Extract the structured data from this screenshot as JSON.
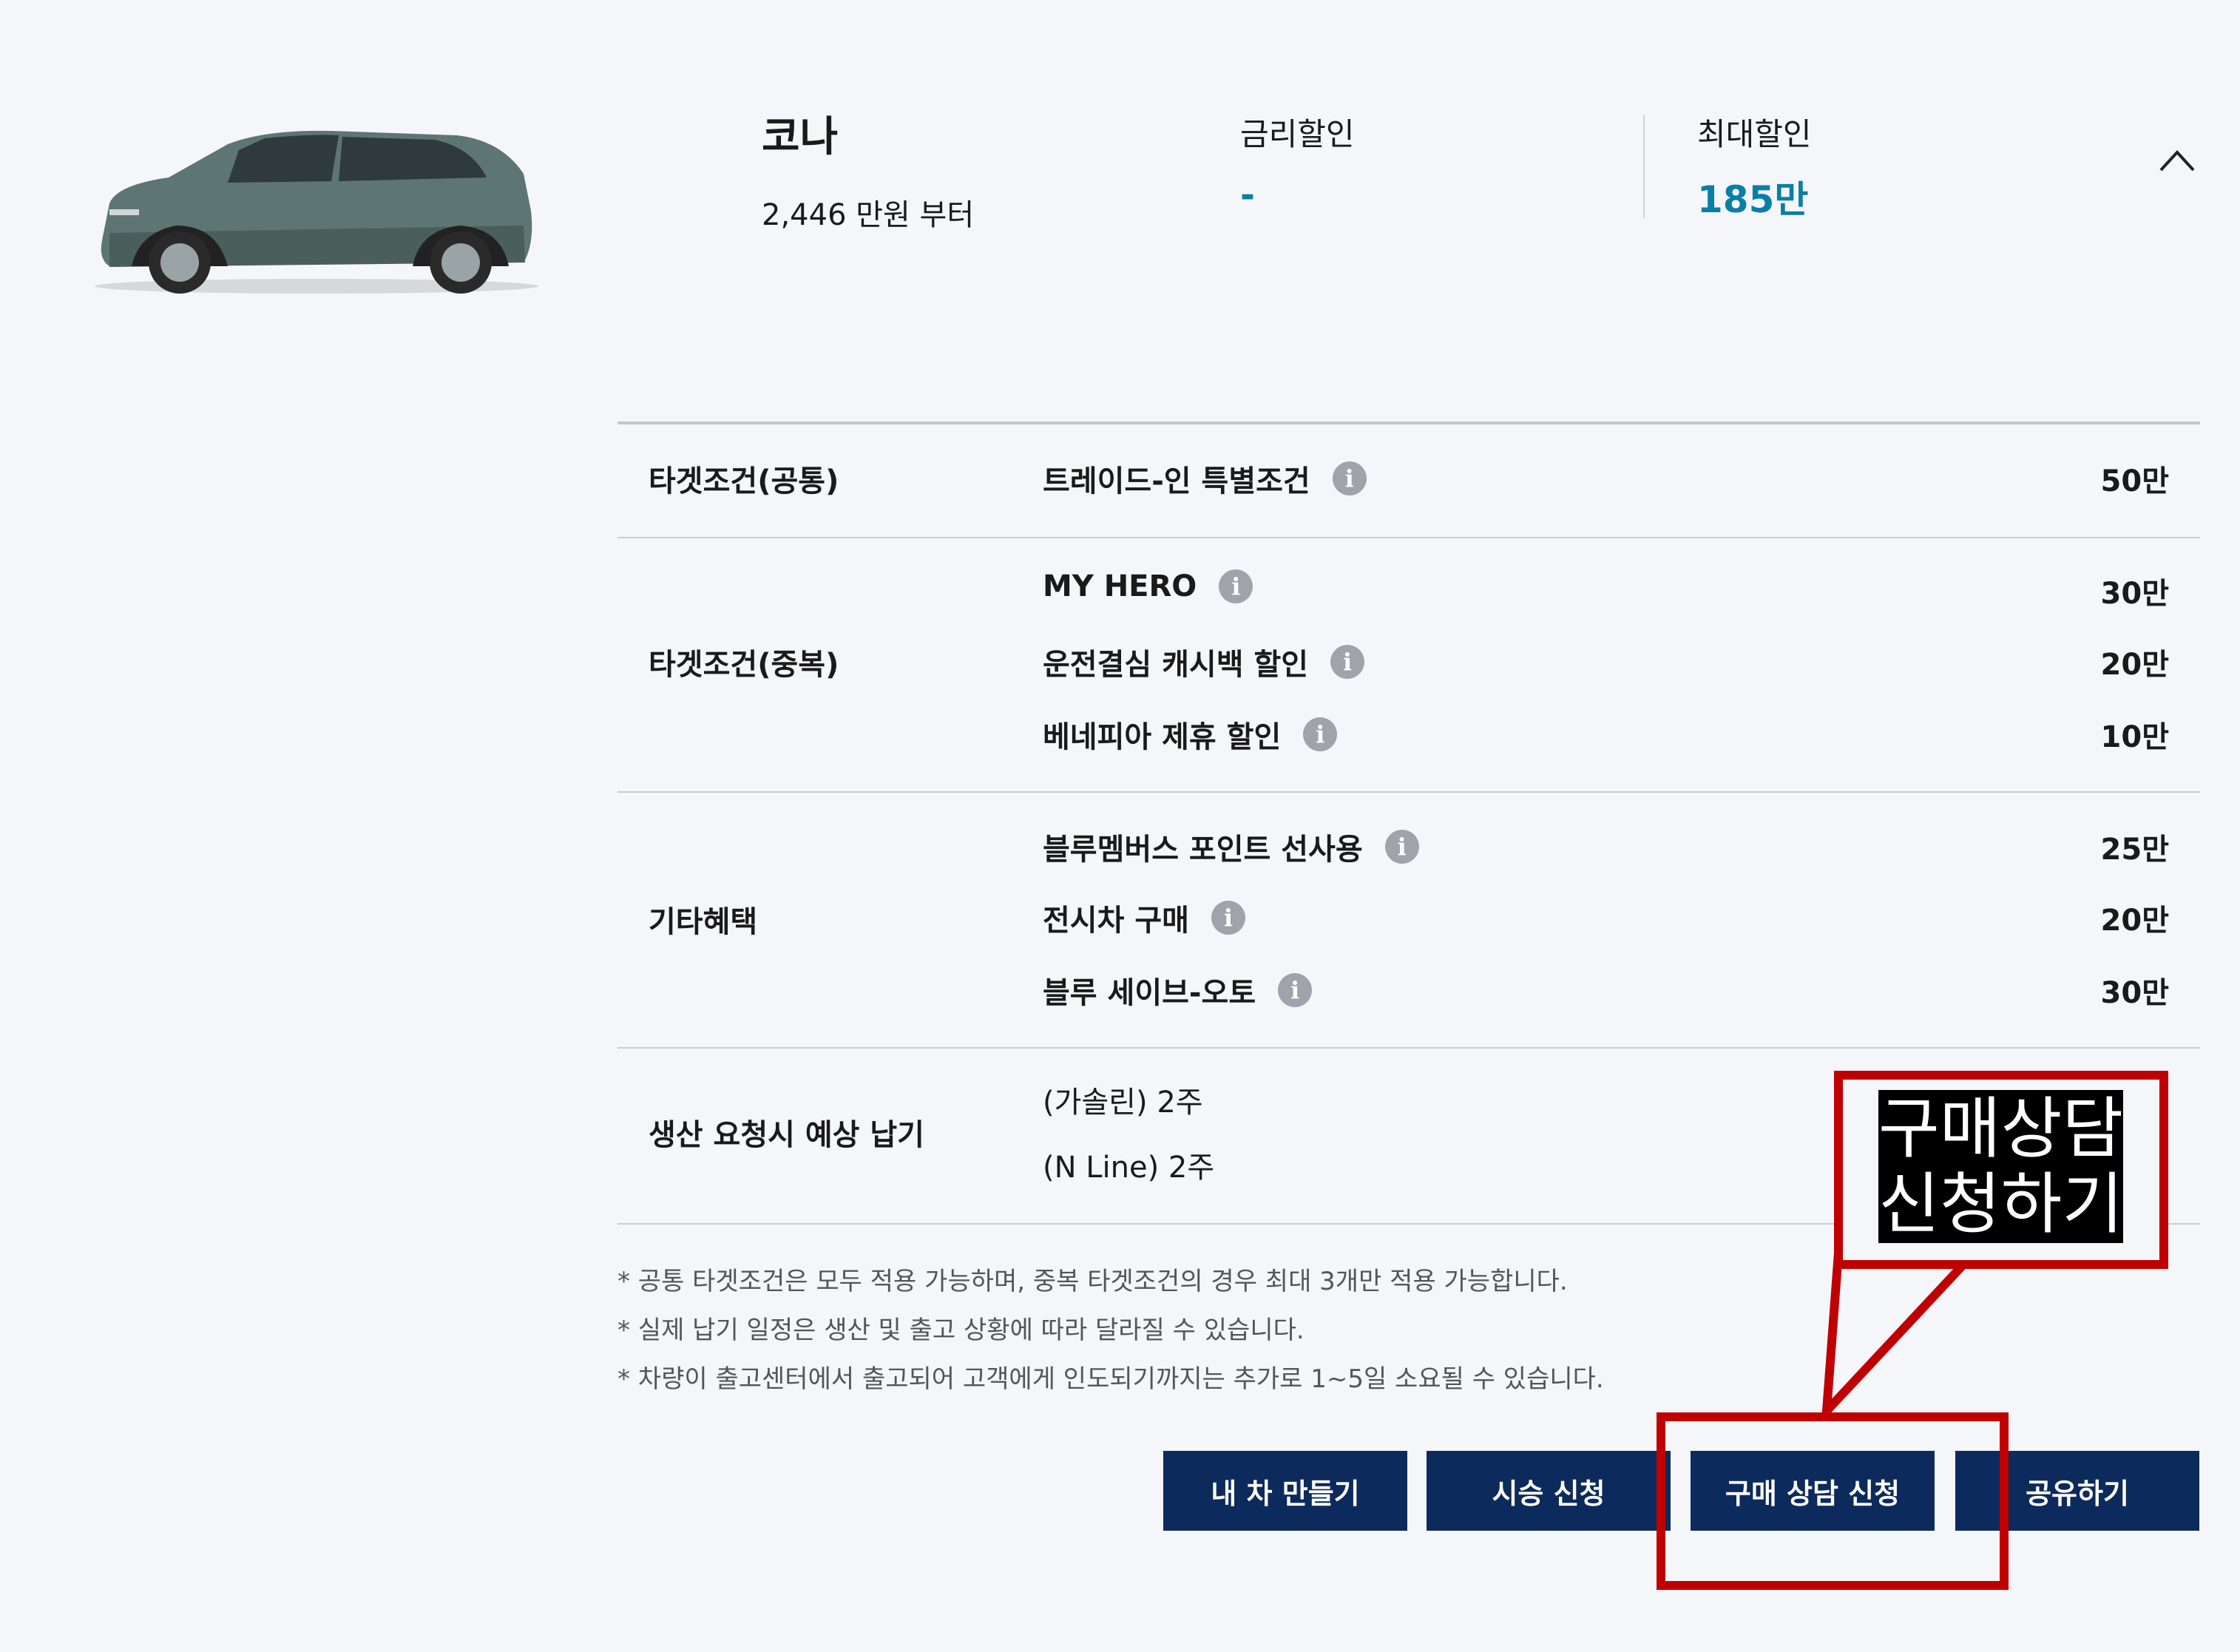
{
  "car": {
    "name": "코나",
    "price_from": "2,446 만원 부터",
    "image_icon": "car-image"
  },
  "summary": {
    "rate_label": "금리할인",
    "rate_value": "-",
    "max_label": "최대할인",
    "max_value": "185만",
    "collapse_icon": "chevron-up-icon"
  },
  "table": {
    "common": {
      "category": "타겟조건(공통)",
      "items": [
        {
          "label": "트레이드-인 특별조건",
          "amount": "50만"
        }
      ]
    },
    "dup": {
      "category": "타겟조건(중복)",
      "items": [
        {
          "label": "MY HERO",
          "amount": "30만"
        },
        {
          "label": "운전결심 캐시백 할인",
          "amount": "20만"
        },
        {
          "label": "베네피아 제휴 할인",
          "amount": "10만"
        }
      ]
    },
    "etc": {
      "category": "기타혜택",
      "items": [
        {
          "label": "블루멤버스 포인트 선사용",
          "amount": "25만"
        },
        {
          "label": "전시차 구매",
          "amount": "20만"
        },
        {
          "label": "블루 세이브-오토",
          "amount": "30만"
        }
      ]
    },
    "delivery": {
      "category": "생산 요청시 예상 납기",
      "lines": [
        "(가솔린) 2주",
        "(N Line) 2주"
      ]
    },
    "info_glyph": "i"
  },
  "notes": [
    "* 공통 타겟조건은 모두 적용 가능하며, 중복 타겟조건의 경우 최대 3개만 적용 가능합니다.",
    "* 실제 납기 일정은 생산 및 출고 상황에 따라 달라질 수 있습니다.",
    "* 차량이 출고센터에서 출고되어 고객에게 인도되기까지는 추가로 1~5일 소요될 수 있습니다."
  ],
  "buttons": {
    "build": "내 차 만들기",
    "test_drive": "시승 신청",
    "consult": "구매 상담 신청",
    "share": "공유하기"
  },
  "callout": {
    "line1": "구매상담",
    "line2": "신청하기"
  },
  "colors": {
    "accent": "#0a7fa6",
    "button_bg": "#0d2a5c",
    "highlight": "#c00000",
    "background": "#f5f6fa"
  }
}
